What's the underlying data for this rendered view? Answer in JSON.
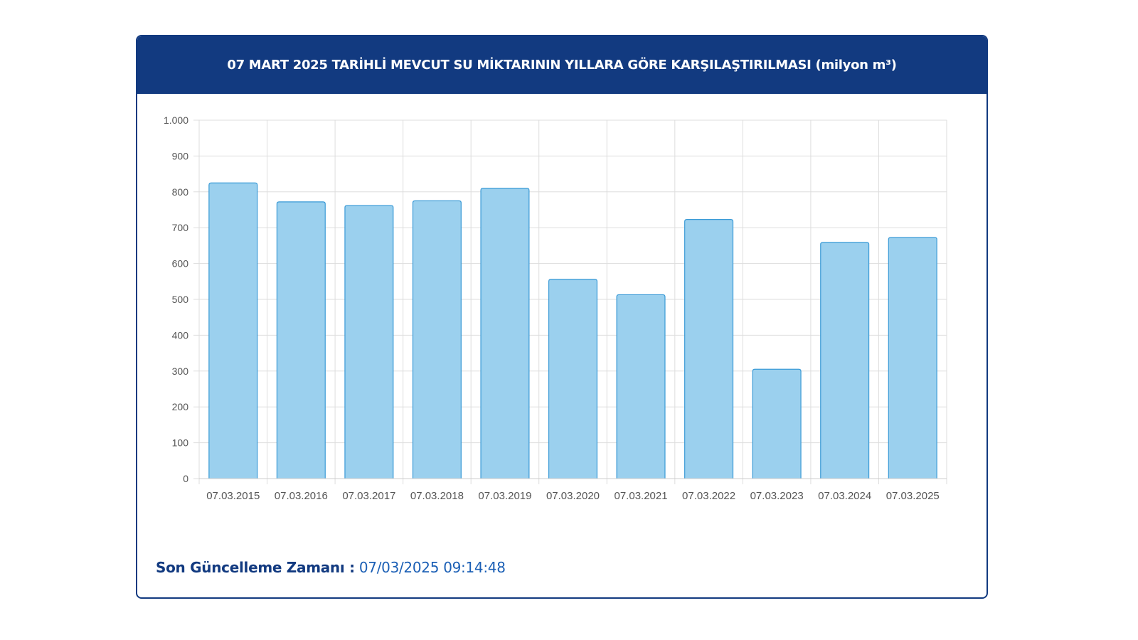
{
  "header": {
    "title": "07 MART 2025 TARİHLİ MEVCUT SU MİKTARININ YILLARA GÖRE KARŞILAŞTIRILMASI (milyon m³)"
  },
  "footer": {
    "label": "Son Güncelleme Zamanı :",
    "value": "07/03/2025 09:14:48"
  },
  "colors": {
    "header_bg": "#123a80",
    "bar_fill": "#9bd0ee",
    "bar_stroke": "#3a9ad6",
    "grid": "#dddddd"
  },
  "chart_data": {
    "type": "bar",
    "categories": [
      "07.03.2015",
      "07.03.2016",
      "07.03.2017",
      "07.03.2018",
      "07.03.2019",
      "07.03.2020",
      "07.03.2021",
      "07.03.2022",
      "07.03.2023",
      "07.03.2024",
      "07.03.2025"
    ],
    "values": [
      825,
      772,
      762,
      775,
      810,
      556,
      513,
      723,
      305,
      659,
      673
    ],
    "ylim": [
      0,
      1000
    ],
    "yticks": [
      0,
      100,
      200,
      300,
      400,
      500,
      600,
      700,
      800,
      900,
      1000
    ],
    "ytick_labels": [
      "0",
      "100",
      "200",
      "300",
      "400",
      "500",
      "600",
      "700",
      "800",
      "900",
      "1.000"
    ],
    "grid": true,
    "legend": "none"
  }
}
